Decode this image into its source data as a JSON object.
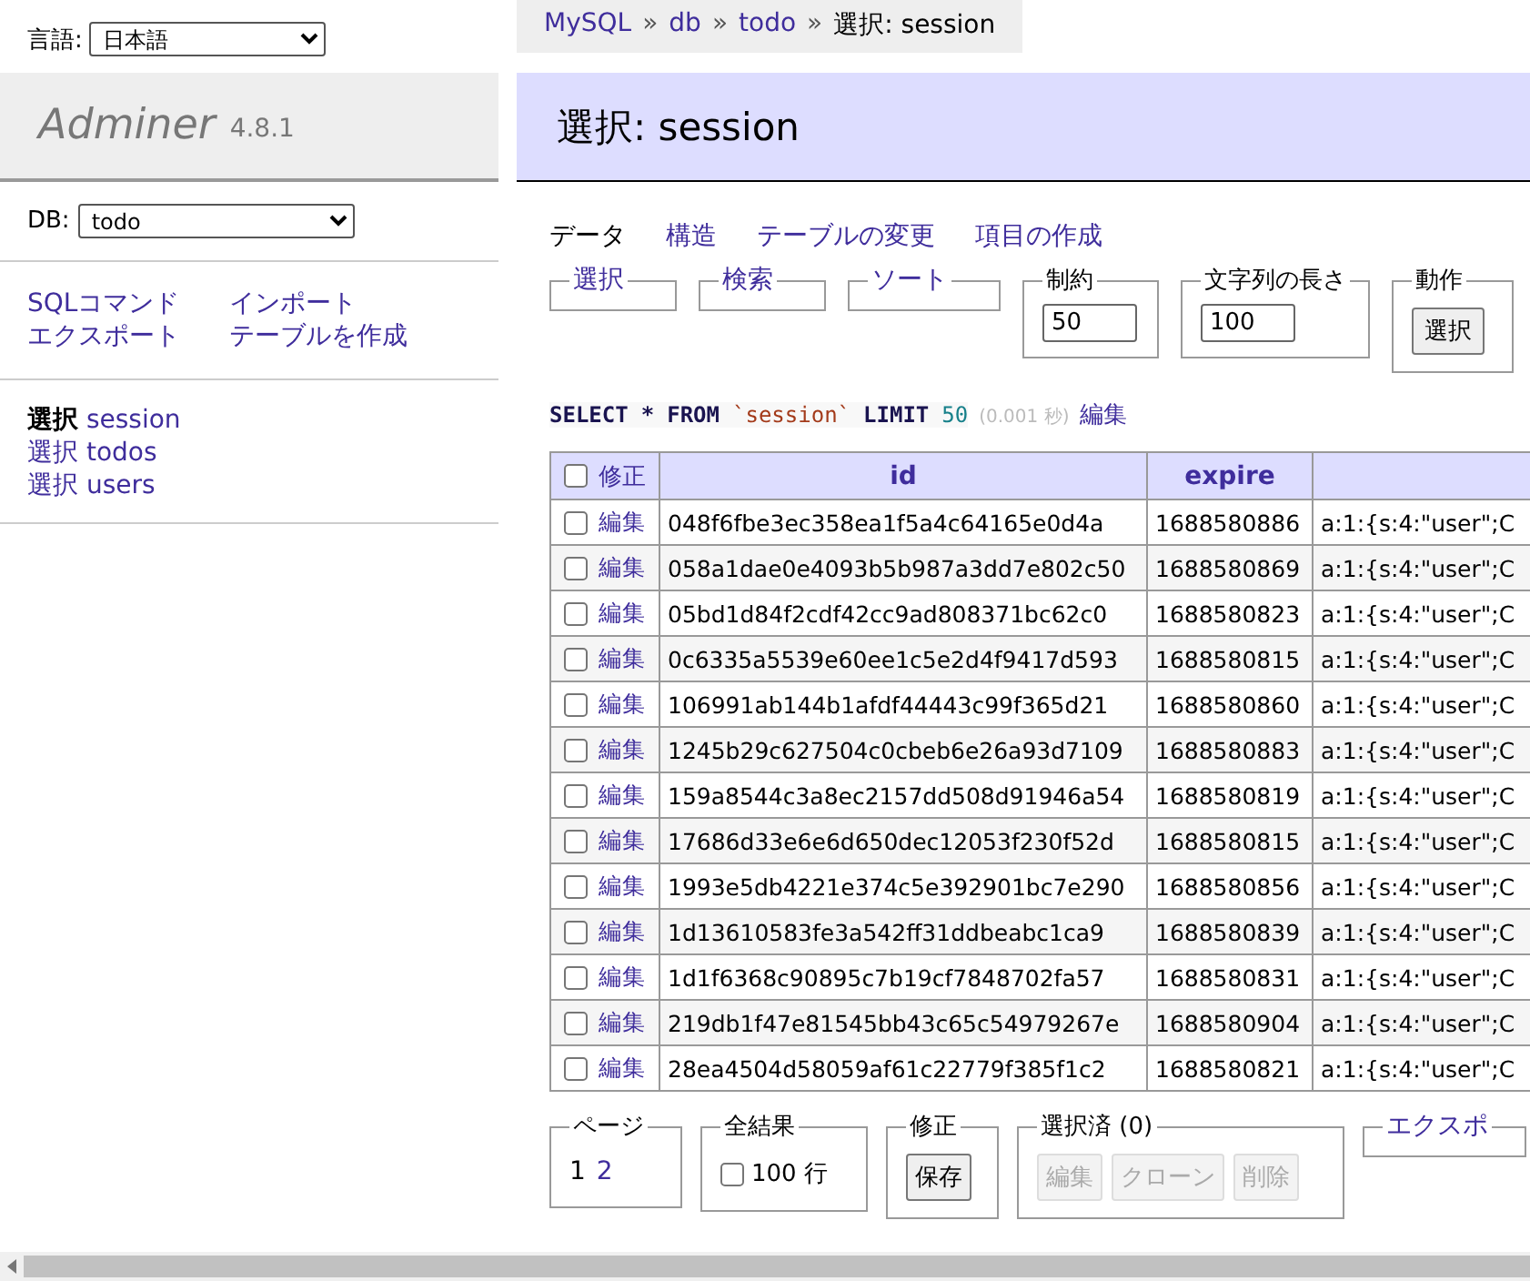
{
  "language": {
    "label": "言語:",
    "value": "日本語"
  },
  "breadcrumb": {
    "separator": "»",
    "items": [
      {
        "text": "MySQL",
        "link": true
      },
      {
        "text": "db",
        "link": true
      },
      {
        "text": "todo",
        "link": true
      },
      {
        "text": "選択: session",
        "link": false
      }
    ]
  },
  "logo": {
    "name": "Adminer",
    "version": "4.8.1"
  },
  "db": {
    "label": "DB:",
    "value": "todo"
  },
  "commands": [
    "SQLコマンド",
    "インポート",
    "エクスポート",
    "テーブルを作成"
  ],
  "tables": [
    {
      "action": "選択",
      "name": "session",
      "selected": true
    },
    {
      "action": "選択",
      "name": "todos",
      "selected": false
    },
    {
      "action": "選択",
      "name": "users",
      "selected": false
    }
  ],
  "title": "選択: session",
  "tabs": [
    {
      "label": "データ",
      "selected": true
    },
    {
      "label": "構造",
      "selected": false
    },
    {
      "label": "テーブルの変更",
      "selected": false
    },
    {
      "label": "項目の作成",
      "selected": false
    }
  ],
  "fieldsets": [
    {
      "kind": "link",
      "legend": "選択"
    },
    {
      "kind": "link",
      "legend": "検索"
    },
    {
      "kind": "link",
      "legend": "ソート"
    },
    {
      "kind": "input",
      "legend": "制約",
      "value": "50"
    },
    {
      "kind": "input",
      "legend": "文字列の長さ",
      "value": "100"
    },
    {
      "kind": "button",
      "legend": "動作",
      "button": "選択"
    }
  ],
  "query": {
    "parts": [
      {
        "kind": "keyword",
        "text": "SELECT"
      },
      {
        "kind": "keyword",
        "text": "*"
      },
      {
        "kind": "keyword",
        "text": "FROM"
      },
      {
        "kind": "identifier",
        "text": "`session`"
      },
      {
        "kind": "keyword",
        "text": "LIMIT"
      },
      {
        "kind": "number",
        "text": "50"
      }
    ],
    "time": "(0.001 秒)",
    "edit": "編集"
  },
  "table": {
    "select_all_checked": false,
    "header_edit": "修正",
    "columns": [
      "id",
      "expire"
    ],
    "rows": [
      {
        "checked": false,
        "edit": "編集",
        "cells": [
          "048f6fbe3ec358ea1f5a4c64165e0d4a",
          "1688580886",
          "a:1:{s:4:\"user\";C"
        ]
      },
      {
        "checked": false,
        "edit": "編集",
        "cells": [
          "058a1dae0e4093b5b987a3dd7e802c50",
          "1688580869",
          "a:1:{s:4:\"user\";C"
        ]
      },
      {
        "checked": false,
        "edit": "編集",
        "cells": [
          "05bd1d84f2cdf42cc9ad808371bc62c0",
          "1688580823",
          "a:1:{s:4:\"user\";C"
        ]
      },
      {
        "checked": false,
        "edit": "編集",
        "cells": [
          "0c6335a5539e60ee1c5e2d4f9417d593",
          "1688580815",
          "a:1:{s:4:\"user\";C"
        ]
      },
      {
        "checked": false,
        "edit": "編集",
        "cells": [
          "106991ab144b1afdf44443c99f365d21",
          "1688580860",
          "a:1:{s:4:\"user\";C"
        ]
      },
      {
        "checked": false,
        "edit": "編集",
        "cells": [
          "1245b29c627504c0cbeb6e26a93d7109",
          "1688580883",
          "a:1:{s:4:\"user\";C"
        ]
      },
      {
        "checked": false,
        "edit": "編集",
        "cells": [
          "159a8544c3a8ec2157dd508d91946a54",
          "1688580819",
          "a:1:{s:4:\"user\";C"
        ]
      },
      {
        "checked": false,
        "edit": "編集",
        "cells": [
          "17686d33e6e6d650dec12053f230f52d",
          "1688580815",
          "a:1:{s:4:\"user\";C"
        ]
      },
      {
        "checked": false,
        "edit": "編集",
        "cells": [
          "1993e5db4221e374c5e392901bc7e290",
          "1688580856",
          "a:1:{s:4:\"user\";C"
        ]
      },
      {
        "checked": false,
        "edit": "編集",
        "cells": [
          "1d13610583fe3a542ff31ddbeabc1ca9",
          "1688580839",
          "a:1:{s:4:\"user\";C"
        ]
      },
      {
        "checked": false,
        "edit": "編集",
        "cells": [
          "1d1f6368c90895c7b19cf7848702fa57",
          "1688580831",
          "a:1:{s:4:\"user\";C"
        ]
      },
      {
        "checked": false,
        "edit": "編集",
        "cells": [
          "219db1f47e81545bb43c65c54979267e",
          "1688580904",
          "a:1:{s:4:\"user\";C"
        ]
      },
      {
        "checked": false,
        "edit": "編集",
        "cells": [
          "28ea4504d58059af61c22779f385f1c2",
          "1688580821",
          "a:1:{s:4:\"user\";C"
        ]
      }
    ]
  },
  "footer": [
    {
      "kind": "pages",
      "legend": "ページ",
      "pages": [
        {
          "text": "1",
          "selected": true
        },
        {
          "text": "2",
          "selected": false
        }
      ]
    },
    {
      "kind": "checkbox",
      "legend": "全結果",
      "checked": false,
      "label": "100 行"
    },
    {
      "kind": "button",
      "legend": "修正",
      "button": "保存"
    },
    {
      "kind": "buttons",
      "legend": "選択済 (0)",
      "buttons": [
        {
          "label": "編集",
          "disabled": true
        },
        {
          "label": "クローン",
          "disabled": true
        },
        {
          "label": "削除",
          "disabled": true
        }
      ]
    },
    {
      "kind": "link-legend",
      "legend": "エクスポ"
    }
  ]
}
